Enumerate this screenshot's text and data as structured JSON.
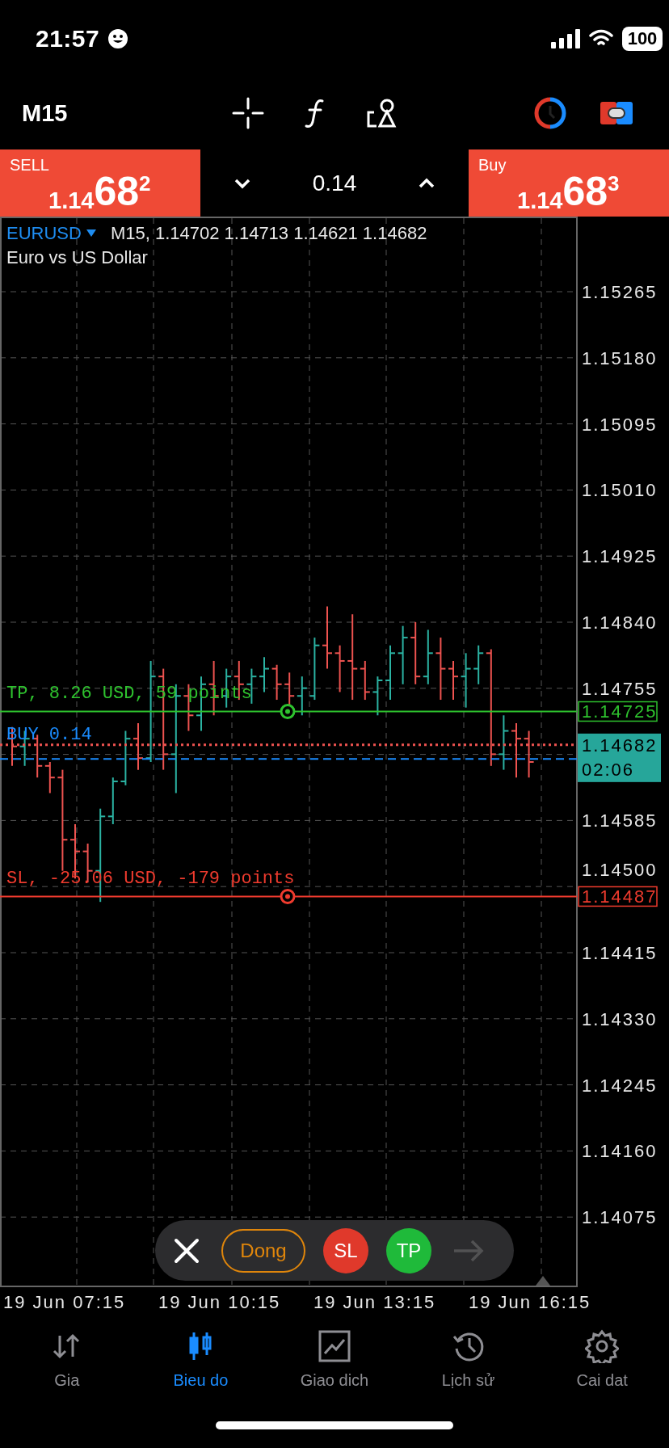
{
  "status_bar": {
    "time": "21:57",
    "battery": "100"
  },
  "toolbar": {
    "timeframe": "M15"
  },
  "trade_panel": {
    "sell": {
      "label": "SELL",
      "price_prefix": "1.14",
      "price_main": "68",
      "price_sup": "2"
    },
    "volume": "0.14",
    "buy": {
      "label": "Buy",
      "price_prefix": "1.14",
      "price_main": "68",
      "price_sup": "3"
    }
  },
  "chart": {
    "symbol": "EURUSD",
    "quote": "M15, 1.14702 1.14713 1.14621 1.14682",
    "description": "Euro vs US Dollar",
    "price_ticks": [
      "1.15265",
      "1.15180",
      "1.15095",
      "1.15010",
      "1.14925",
      "1.14840",
      "1.14755",
      "1.14585",
      "1.14500",
      "1.14415",
      "1.14330",
      "1.14245",
      "1.14160",
      "1.14075"
    ],
    "time_ticks": [
      "19 Jun 07:15",
      "19 Jun 10:15",
      "19 Jun 13:15",
      "19 Jun 16:15"
    ],
    "tp_line": {
      "label": "TP, 8.26 USD, 59 points",
      "price": "1.14725"
    },
    "order_line": {
      "label": "BUY 0.14"
    },
    "current_price": {
      "price": "1.14682",
      "countdown": "02:06"
    },
    "sl_line": {
      "label": "SL, -25.06 USD, -179 points",
      "price": "1.14487"
    }
  },
  "order_bar": {
    "buttons": [
      {
        "kind": "close",
        "disabled": false
      },
      {
        "kind": "text",
        "label": "Dong",
        "disabled": false
      },
      {
        "kind": "sl",
        "label": "SL",
        "disabled": false
      },
      {
        "kind": "tp",
        "label": "TP",
        "disabled": false
      },
      {
        "kind": "arrow",
        "disabled": true
      }
    ]
  },
  "tabs": [
    {
      "kind": "quotes",
      "label": "Gia",
      "selected": false
    },
    {
      "kind": "chart",
      "label": "Bieu do",
      "selected": true
    },
    {
      "kind": "trade",
      "label": "Giao dich",
      "selected": false
    },
    {
      "kind": "history",
      "label": "Lịch sử",
      "selected": false
    },
    {
      "kind": "settings",
      "label": "Cai dat",
      "selected": false
    }
  ]
}
